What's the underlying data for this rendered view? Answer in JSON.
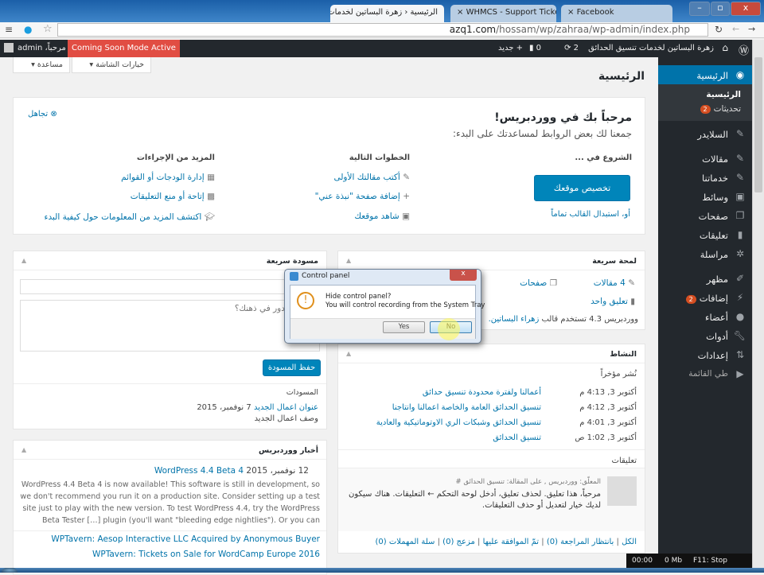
{
  "browser": {
    "tabs": [
      {
        "label": "الرئيسية ‹ زهرة البساتين لخدمات ت"
      },
      {
        "label": "WHMCS - Support Tickets"
      },
      {
        "label": "Facebook"
      }
    ],
    "url_domain": "azq1.com",
    "url_path": "/hossam/wp/zahraa/wp-admin/index.php"
  },
  "adminbar": {
    "site_name": "زهرة البساتين لخدمات تنسيق الحدائق",
    "updates": "2",
    "comments": "0",
    "new": "جديد",
    "coming_soon": "Coming Soon Mode Active",
    "greeting": "مرحباً، admin"
  },
  "top_buttons": {
    "screen_options": "خيارات الشاشة",
    "help": "مساعدة"
  },
  "page_title": "الرئيسية",
  "sidebar": {
    "items": [
      {
        "label": "الرئيسية",
        "icon": "dashboard-icon"
      },
      {
        "label": "السلايدر",
        "icon": "pin-icon"
      },
      {
        "label": "مقالات",
        "icon": "pin-icon"
      },
      {
        "label": "خدماتنا",
        "icon": "pin-icon"
      },
      {
        "label": "وسائط",
        "icon": "media-icon"
      },
      {
        "label": "صفحات",
        "icon": "pages-icon"
      },
      {
        "label": "تعليقات",
        "icon": "comment-icon"
      },
      {
        "label": "مراسلة",
        "icon": "gear-icon"
      },
      {
        "label": "مظهر",
        "icon": "brush-icon"
      },
      {
        "label": "إضافات",
        "icon": "plugin-icon",
        "badge": "2"
      },
      {
        "label": "أعضاء",
        "icon": "user-icon"
      },
      {
        "label": "أدوات",
        "icon": "wrench-icon"
      },
      {
        "label": "إعدادات",
        "icon": "settings-icon"
      },
      {
        "label": "طي القائمة",
        "icon": "collapse-icon"
      }
    ],
    "sub": {
      "home": "الرئيسية",
      "updates": "تحديثات",
      "updates_badge": "2"
    }
  },
  "welcome": {
    "title": "مرحباً بك في ووردبريس!",
    "subtitle": "جمعنا لك بعض الروابط لمساعدتك على البدء:",
    "dismiss": "تجاهل",
    "start_heading": "الشروع في ...",
    "customize_button": "تخصيص موقعك",
    "change_theme": "أو، استبدال القالب تماماً",
    "next_heading": "الخطوات التالية",
    "next": [
      "أكتب مقالتك الأولى",
      "إضافة صفحة \"نبذة عني\"",
      "شاهد موقعك"
    ],
    "more_heading": "المزيد من الإجراءات",
    "more": [
      "إدارة الودجات أو القوائم",
      "إتاحة أو منع التعليقات",
      "اكتشف المزيد من المعلومات حول كيفية البدء"
    ]
  },
  "glance": {
    "title": "لمحة سريعة",
    "posts": "4 مقالات",
    "pages": "صفحات",
    "comments": "تعليق واحد",
    "theme_text": "ووردبريس 4.3 تستخدم قالب",
    "theme_name": "زهراء البساتين."
  },
  "activity": {
    "title": "النشاط",
    "recent": "نُشر مؤخراً",
    "items": [
      {
        "date": "أكتوبر 3, 4:13 م",
        "title": "أعمالنا ولفترة محدودة تنسيق حدائق"
      },
      {
        "date": "أكتوبر 3, 4:12 م",
        "title": "تنسيق الحدائق العامة والخاصة اعمالنا وانتاجنا"
      },
      {
        "date": "أكتوبر 3, 4:01 م",
        "title": "تنسيق الحدائق وشبكات الري الاوتوماتيكية والعادية"
      },
      {
        "date": "أكتوبر 3, 1:02 ص",
        "title": "تنسيق الحدائق"
      }
    ],
    "comments_heading": "تعليقات",
    "comment_meta": "المعلّق: ووردبريس , على المقالة: تنسيق الحدائق #",
    "comment_text": "مرحباً، هذا تعليق. لحذف تعليق، أدخل لوحة التحكم ← التعليقات. هناك سيكون لديك خيار لتعديل أو حذف التعليقات.",
    "filters": [
      "الكل",
      "بانتظار المراجعة (0)",
      "تمّ الموافقة عليها",
      "مزعج (0)",
      "سلة المهملات (0)"
    ]
  },
  "draft": {
    "title": "مسودة سريعة",
    "title_placeholder": "العنوان",
    "content_placeholder": "ما الذي يدور في ذهنك؟",
    "save": "حفظ المسودة",
    "drafts_heading": "المسودات",
    "draft_title": "عنوان اعمال الجديد",
    "draft_date": "7 نوفمبر، 2015",
    "draft_excerpt": "وصف اعمال الجديد"
  },
  "news": {
    "title": "أخبار ووردبريس",
    "item_title": "WordPress 4.4 Beta 4",
    "item_date": "12 نوفمبر، 2015",
    "item_text": "WordPress 4.4 Beta 4 is now available! This software is still in development, so we don't recommend you run it on a production site. Consider setting up a test site just to play with the new version. To test WordPress 4.4, try the WordPress Beta Tester […] plugin (you'll want \"bleeding edge nightlies\"). Or you can",
    "links": [
      "WPTavern: Aesop Interactive LLC Acquired by Anonymous Buyer",
      "WPTavern: Tickets on Sale for WordCamp Europe 2016"
    ]
  },
  "dialog": {
    "title": "Control panel",
    "line1": "Hide control panel?",
    "line2": "You will control recording from the System Tray",
    "yes": "Yes",
    "no": "No"
  },
  "recorder": {
    "time": "00:00",
    "size": "0 Mb",
    "stop": "F11: Stop"
  }
}
